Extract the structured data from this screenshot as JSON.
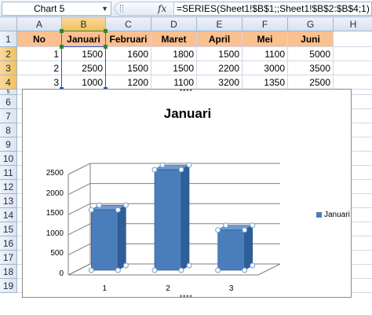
{
  "name_box": {
    "value": "Chart 5"
  },
  "formula_bar": {
    "fx_label": "fx",
    "formula": "=SERIES(Sheet1!$B$1;;Sheet1!$B$2:$B$4;1)"
  },
  "columns": [
    "A",
    "B",
    "C",
    "D",
    "E",
    "F",
    "G",
    "H"
  ],
  "rows": [
    "1",
    "2",
    "3",
    "4",
    "5",
    "6",
    "7",
    "8",
    "9",
    "10",
    "11",
    "12",
    "13",
    "14",
    "15",
    "16",
    "17",
    "18",
    "19"
  ],
  "table": {
    "headers": [
      "No",
      "Januari",
      "Februari",
      "Maret",
      "April",
      "Mei",
      "Juni"
    ],
    "rows": [
      [
        "1",
        "1500",
        "1600",
        "1800",
        "1500",
        "1100",
        "5000"
      ],
      [
        "2",
        "2500",
        "1500",
        "1500",
        "2200",
        "3000",
        "3500"
      ],
      [
        "3",
        "1000",
        "1200",
        "1100",
        "3200",
        "1350",
        "2500"
      ]
    ]
  },
  "colors": {
    "header_fill": "#fac090",
    "bar": "#4a7ebb",
    "selection": "#1f4fd8",
    "series_highlight": "#2c8a2c"
  },
  "chart_data": {
    "type": "bar",
    "title": "Januari",
    "categories": [
      "1",
      "2",
      "3"
    ],
    "series": [
      {
        "name": "Januari",
        "values": [
          1500,
          2500,
          1000
        ]
      }
    ],
    "ylim": [
      0,
      2500
    ],
    "yticks": [
      "0",
      "500",
      "1000",
      "1500",
      "2000",
      "2500"
    ],
    "grid": true,
    "legend_position": "right",
    "style": "3d-clustered-column"
  }
}
